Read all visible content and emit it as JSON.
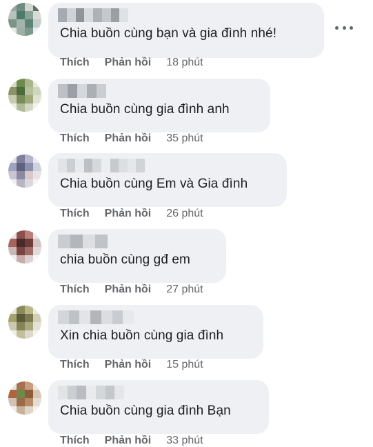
{
  "comments": [
    {
      "message": "Chia buồn cùng bạn và gia đình nhé!",
      "like": "Thích",
      "reply": "Phản hồi",
      "time": "18 phút",
      "avatar_colors": [
        "#9aa5a0",
        "#6e8c80",
        "#cfd6d2",
        "#5e7168",
        "#b8c2bd",
        "#4f7a6b",
        "#8aa397",
        "#d5dcd8",
        "#7b9589",
        "#a4b4ac",
        "#5d8576",
        "#c6cfca",
        "#e2e7e4",
        "#9db0a7",
        "#7d978b",
        "#edf0ee"
      ],
      "name_colors": [
        "#9aa0a6",
        "#c9ccd1",
        "#7f858b",
        "#d4d7db",
        "#a3a8ad",
        "#bfc3c8",
        "#8c9297",
        "#dde0e3"
      ]
    },
    {
      "message": "Chia buồn cùng gia đình anh",
      "like": "Thích",
      "reply": "Phản hồi",
      "time": "35 phút",
      "avatar_colors": [
        "#d9dbc8",
        "#6f8a4e",
        "#a8b48a",
        "#e6e8da",
        "#8a9466",
        "#4d6a3a",
        "#b7c09c",
        "#cfd4bd",
        "#c7cbb2",
        "#7a8b5a",
        "#9ea878",
        "#e0e3d3",
        "#eceee4",
        "#b3ba98",
        "#d4d8c2",
        "#f2f3ec"
      ],
      "name_colors": [
        "#b5b9be",
        "#8e9399",
        "#d0d3d7",
        "#a0a5ab",
        "#c4c8cc"
      ]
    },
    {
      "message": "Chia buồn cùng Em và Gia đình",
      "like": "Thích",
      "reply": "Phản hồi",
      "time": "26 phút",
      "avatar_colors": [
        "#e4dfe6",
        "#7e7f9c",
        "#b5b6cc",
        "#e9e6ec",
        "#a0a3bd",
        "#5e627f",
        "#8d90ac",
        "#cfd0dd",
        "#c9c4cf",
        "#8a8aa3",
        "#d8c9c8",
        "#e5e2e8",
        "#f0eef2",
        "#b9b5c2",
        "#dcd8e0",
        "#f4f3f6"
      ],
      "name_colors": [
        "#dfe1e4",
        "#c6c9cd",
        "#e8eaec",
        "#b4b8bc",
        "#d2d5d8",
        "#eceef0",
        "#c0c3c7",
        "#dadcdf",
        "#e4e6e8",
        "#cdd0d3"
      ]
    },
    {
      "message": "chia buồn cùng gđ em",
      "like": "Thích",
      "reply": "Phản hồi",
      "time": "27 phút",
      "avatar_colors": [
        "#e8e2e2",
        "#8c4f4a",
        "#b97f78",
        "#ece7e7",
        "#a8635a",
        "#4a2a2a",
        "#6d3b38",
        "#d3c3c2",
        "#c9b8b7",
        "#7a4540",
        "#9c6b66",
        "#e2dada",
        "#f1eeee",
        "#c7aeac",
        "#ddd2d1",
        "#f6f4f4"
      ],
      "name_colors": [
        "#c3c6ca",
        "#a9adb2",
        "#d9dbde",
        "#b8bcc0"
      ]
    },
    {
      "message": "Xin chia buồn cùng gia đình",
      "like": "Thích",
      "reply": "Phản hồi",
      "time": "15 phút",
      "avatar_colors": [
        "#e6e4d8",
        "#8b8a58",
        "#b9b68a",
        "#ebeae2",
        "#a6a06a",
        "#5a5a3c",
        "#7d7a50",
        "#d2cfb9",
        "#ccc9b2",
        "#868456",
        "#a9a77c",
        "#e3e1d5",
        "#efeee8",
        "#c2bf9f",
        "#dcdacb",
        "#f4f3ef"
      ],
      "name_colors": [
        "#cfd2d5",
        "#b7bbbf",
        "#e1e3e5",
        "#a8acb1",
        "#d8dadd",
        "#c2c5c9",
        "#e6e8ea"
      ]
    },
    {
      "message": "Chia buồn cùng gia đình Bạn",
      "like": "Thích",
      "reply": "Phản hồi",
      "time": "33 phút",
      "avatar_colors": [
        "#e7e3dc",
        "#a5714f",
        "#c99e7e",
        "#ece8e2",
        "#b1633f",
        "#6e8a4a",
        "#8f5c3b",
        "#d8c6b5",
        "#d0c3b3",
        "#9b6a4a",
        "#b98866",
        "#e4ddd3",
        "#f0ede8",
        "#c9b29a",
        "#ded4c7",
        "#f5f3ef"
      ],
      "name_colors": [
        "#dfe1e3",
        "#c7cacd",
        "#b0b4b8",
        "#e7e9eb",
        "#d0d3d6",
        "#bdc1c4",
        "#e3e5e7"
      ]
    }
  ]
}
